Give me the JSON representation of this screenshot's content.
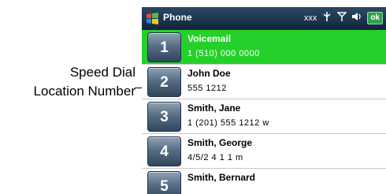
{
  "callout": {
    "line1": "Speed Dial",
    "line2": "Location Number"
  },
  "titlebar": {
    "title": "Phone",
    "network": "xxx",
    "ok_label": "ok"
  },
  "entries": [
    {
      "slot": "1",
      "name": "Voicemail",
      "number": "1 (510) 000 0000"
    },
    {
      "slot": "2",
      "name": "John Doe",
      "number": "555 1212"
    },
    {
      "slot": "3",
      "name": "Smith, Jane",
      "number": "1 (201) 555 1212 w"
    },
    {
      "slot": "4",
      "name": "Smith, George",
      "number": "4/5/2 4 1 1 m"
    },
    {
      "slot": "5",
      "name": "Smith, Bernard",
      "number": ""
    }
  ],
  "colors": {
    "selected_row": "#26d02a",
    "titlebar": "#1c344c",
    "dial_button": "#546b82"
  },
  "icons": [
    "windows-start-icon",
    "signal-icon",
    "antenna-icon",
    "speaker-icon"
  ]
}
